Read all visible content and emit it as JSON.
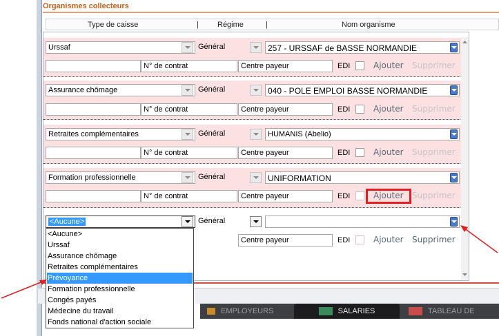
{
  "section_title": "Organismes collecteurs",
  "columns": [
    "Type de caisse",
    "Régime",
    "Nom organisme"
  ],
  "rows": [
    {
      "type": "Urssaf",
      "regime": "Général",
      "organisme": "257 - URSSAF de BASSE NORMANDIE",
      "contrat_label": "N° de contrat",
      "centre_label": "Centre payeur",
      "edi_label": "EDI",
      "ajouter": "Ajouter",
      "supprimer": "Supprimer"
    },
    {
      "type": "Assurance chômage",
      "regime": "Général",
      "organisme": "040 - POLE EMPLOI BASSE NORMANDIE",
      "contrat_label": "N° de contrat",
      "centre_label": "Centre payeur",
      "edi_label": "EDI",
      "ajouter": "Ajouter",
      "supprimer": "Supprimer"
    },
    {
      "type": "Retraites complémentaires",
      "regime": "Général",
      "organisme": "HUMANIS (Abelio)",
      "contrat_label": "N° de contrat",
      "centre_label": "Centre payeur",
      "edi_label": "EDI",
      "ajouter": "Ajouter",
      "supprimer": "Supprimer"
    },
    {
      "type": "Formation professionnelle",
      "regime": "Général",
      "organisme": "UNIFORMATION",
      "contrat_label": "N° de contrat",
      "centre_label": "Centre payeur",
      "edi_label": "EDI",
      "ajouter": "Ajouter",
      "supprimer": "Supprimer"
    },
    {
      "type": "<Aucune>",
      "regime": "Général",
      "organisme": "",
      "centre_label": "Centre payeur",
      "edi_label": "EDI",
      "ajouter": "Ajouter",
      "supprimer": "Supprimer"
    }
  ],
  "dropdown_options": [
    "<Aucune>",
    "Urssaf",
    "Assurance chômage",
    "Retraites complémentaires",
    "Prévoyance",
    "Formation professionnelle",
    "Congés payés",
    "Médecine du travail",
    "Fonds national d'action sociale"
  ],
  "dropdown_highlighted": "Prévoyance",
  "taskbar": {
    "employeurs": "EMPLOYEURS",
    "salaries": "SALARIES",
    "tableau": "TABLEAU DE"
  },
  "colors": {
    "accent_orange": "#c8601a",
    "row_bg": "#fbe1e1",
    "highlight_red": "#e02020",
    "selection_blue": "#3399ff",
    "arrow_red": "#e02020"
  }
}
